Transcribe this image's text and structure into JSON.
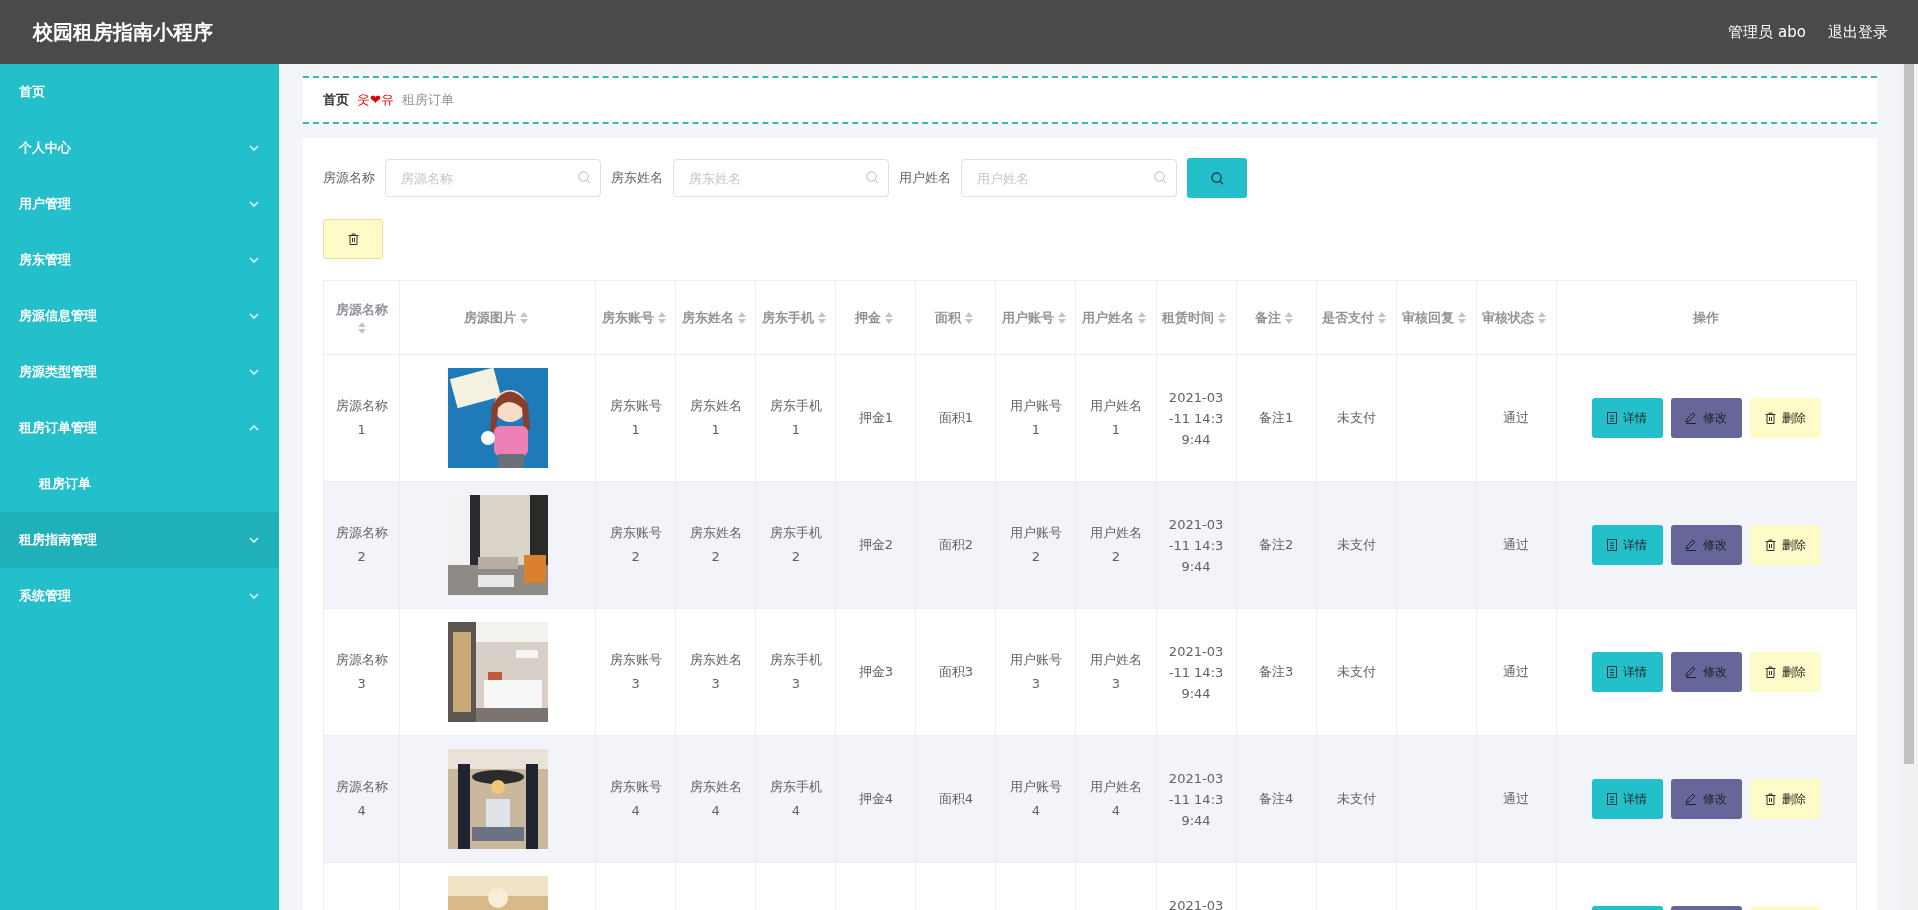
{
  "header": {
    "title": "校园租房指南小程序",
    "user": "管理员 abo",
    "logout": "退出登录"
  },
  "sidebar": {
    "items": [
      {
        "label": "首页",
        "kind": "link",
        "hovered": false
      },
      {
        "label": "个人中心",
        "kind": "menu",
        "expanded": false,
        "hovered": false
      },
      {
        "label": "用户管理",
        "kind": "menu",
        "expanded": false,
        "hovered": false
      },
      {
        "label": "房东管理",
        "kind": "menu",
        "expanded": false,
        "hovered": false
      },
      {
        "label": "房源信息管理",
        "kind": "menu",
        "expanded": false,
        "hovered": false
      },
      {
        "label": "房源类型管理",
        "kind": "menu",
        "expanded": false,
        "hovered": false
      },
      {
        "label": "租房订单管理",
        "kind": "menu",
        "expanded": true,
        "hovered": false,
        "children": [
          {
            "label": "租房订单",
            "hovered": false
          }
        ]
      },
      {
        "label": "租房指南管理",
        "kind": "menu",
        "expanded": false,
        "hovered": true
      },
      {
        "label": "系统管理",
        "kind": "menu",
        "expanded": false,
        "hovered": false
      }
    ]
  },
  "breadcrumb": {
    "home": "首页",
    "separator": "웃❤유",
    "current": "租房订单"
  },
  "search": {
    "fields": [
      {
        "label": "房源名称",
        "placeholder": "房源名称"
      },
      {
        "label": "房东姓名",
        "placeholder": "房东姓名"
      },
      {
        "label": "用户姓名",
        "placeholder": "用户姓名"
      }
    ]
  },
  "table": {
    "columns": [
      {
        "label": "房源名称",
        "sortable": true
      },
      {
        "label": "房源图片",
        "sortable": true
      },
      {
        "label": "房东账号",
        "sortable": true
      },
      {
        "label": "房东姓名",
        "sortable": true
      },
      {
        "label": "房东手机",
        "sortable": true
      },
      {
        "label": "押金",
        "sortable": true
      },
      {
        "label": "面积",
        "sortable": true
      },
      {
        "label": "用户账号",
        "sortable": true
      },
      {
        "label": "用户姓名",
        "sortable": true
      },
      {
        "label": "租赁时间",
        "sortable": true
      },
      {
        "label": "备注",
        "sortable": true
      },
      {
        "label": "是否支付",
        "sortable": true
      },
      {
        "label": "审核回复",
        "sortable": true
      },
      {
        "label": "审核状态",
        "sortable": true
      },
      {
        "label": "操作",
        "sortable": false
      }
    ],
    "rows": [
      {
        "cells": [
          "房源名称1",
          null,
          "房东账号1",
          "房东姓名1",
          "房东手机1",
          "押金1",
          "面积1",
          "用户账号1",
          "用户姓名1",
          "2021-03-11 14:39:44",
          "备注1",
          "未支付",
          "",
          "通过"
        ],
        "actions": [
          {
            "kind": "detail",
            "label": "详情"
          },
          {
            "kind": "edit",
            "label": "修改"
          },
          {
            "kind": "delete",
            "label": "删除"
          }
        ]
      },
      {
        "cells": [
          "房源名称2",
          null,
          "房东账号2",
          "房东姓名2",
          "房东手机2",
          "押金2",
          "面积2",
          "用户账号2",
          "用户姓名2",
          "2021-03-11 14:39:44",
          "备注2",
          "未支付",
          "",
          "通过"
        ],
        "actions": [
          {
            "kind": "detail",
            "label": "详情"
          },
          {
            "kind": "edit",
            "label": "修改"
          },
          {
            "kind": "delete",
            "label": "删除"
          }
        ]
      },
      {
        "cells": [
          "房源名称3",
          null,
          "房东账号3",
          "房东姓名3",
          "房东手机3",
          "押金3",
          "面积3",
          "用户账号3",
          "用户姓名3",
          "2021-03-11 14:39:44",
          "备注3",
          "未支付",
          "",
          "通过"
        ],
        "actions": [
          {
            "kind": "detail",
            "label": "详情"
          },
          {
            "kind": "edit",
            "label": "修改"
          },
          {
            "kind": "delete",
            "label": "删除"
          }
        ]
      },
      {
        "cells": [
          "房源名称4",
          null,
          "房东账号4",
          "房东姓名4",
          "房东手机4",
          "押金4",
          "面积4",
          "用户账号4",
          "用户姓名4",
          "2021-03-11 14:39:44",
          "备注4",
          "未支付",
          "",
          "通过"
        ],
        "actions": [
          {
            "kind": "detail",
            "label": "详情"
          },
          {
            "kind": "edit",
            "label": "修改"
          },
          {
            "kind": "delete",
            "label": "删除"
          }
        ]
      },
      {
        "cells": [
          "",
          null,
          "",
          "",
          "",
          "",
          "",
          "",
          "",
          "2021-03",
          "",
          "",
          "",
          ""
        ],
        "actions": [
          {
            "kind": "detail"
          },
          {
            "kind": "edit"
          },
          {
            "kind": "delete"
          }
        ]
      }
    ]
  }
}
